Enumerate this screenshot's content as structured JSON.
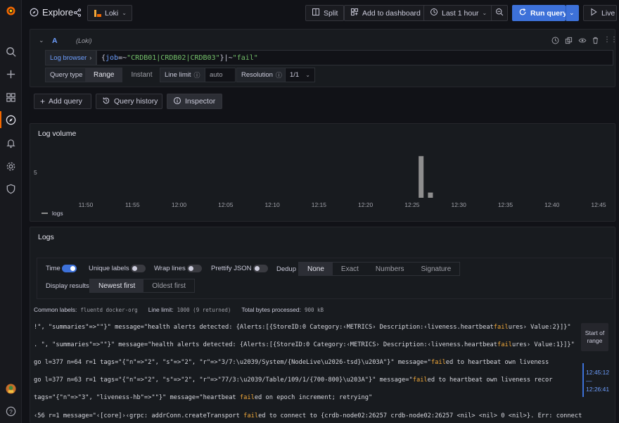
{
  "topbar": {
    "title": "Explore",
    "datasource": "Loki",
    "split": "Split",
    "add_to_dashboard": "Add to dashboard",
    "time_range": "Last 1 hour",
    "run_query": "Run query",
    "live": "Live"
  },
  "query": {
    "letter": "A",
    "datasource_label": "(Loki)",
    "log_browser": "Log browser",
    "expr_open": "{",
    "expr_job_key": "job",
    "expr_job_op": "=~",
    "expr_job_val": "\"CRDB01|CRDB02|CRDB03\"",
    "expr_close": "}",
    "expr_filter_op": "|~",
    "expr_filter_val": "\"fail\"",
    "query_type_label": "Query type",
    "range": "Range",
    "instant": "Instant",
    "line_limit_label": "Line limit",
    "line_limit_placeholder": "auto",
    "resolution_label": "Resolution",
    "resolution_value": "1/1"
  },
  "actions": {
    "add_query": "Add query",
    "query_history": "Query history",
    "inspector": "Inspector"
  },
  "log_volume": {
    "title": "Log volume",
    "y_tick": "5",
    "legend": "logs",
    "color": "#8e8e8e"
  },
  "chart_data": {
    "type": "bar",
    "title": "Log volume",
    "x_ticks": [
      "11:50",
      "11:55",
      "12:00",
      "12:05",
      "12:10",
      "12:15",
      "12:20",
      "12:25",
      "12:30",
      "12:35",
      "12:40",
      "12:45"
    ],
    "series": [
      {
        "name": "logs",
        "x": [
          "12:26",
          "12:27"
        ],
        "values": [
          8,
          1
        ]
      }
    ],
    "y_ticks": [
      "5"
    ]
  },
  "logs": {
    "title": "Logs",
    "time_label": "Time",
    "unique_labels": "Unique labels",
    "wrap_lines": "Wrap lines",
    "prettify_json": "Prettify JSON",
    "dedup_label": "Dedup",
    "dedup_options": [
      "None",
      "Exact",
      "Numbers",
      "Signature"
    ],
    "display_results_label": "Display results",
    "newest_first": "Newest first",
    "oldest_first": "Oldest first",
    "common_labels_label": "Common labels:",
    "common_label_values": "fluentd docker-org",
    "line_limit_text": "Line limit:",
    "line_limit_value": "1000 (9 returned)",
    "total_bytes_text": "Total bytes processed:",
    "total_bytes_value": "900 kB",
    "start_of_range": "Start of range",
    "range_top": "12:45:12",
    "range_dash": "—",
    "range_bottom": "12:26:41",
    "lines": [
      {
        "pre": "!\", \"summaries\"=>\"\"}\" message=\"health alerts detected: {Alerts:[{StoreID:0 Category:‹METRICS› Description:‹liveness.heartbeat",
        "hl": "fail",
        "post": "ures› Value:2}]}\""
      },
      {
        "pre": ". \", \"summaries\"=>\"\"}\" message=\"health alerts detected: {Alerts:[{StoreID:0 Category:‹METRICS› Description:‹liveness.heartbeat",
        "hl": "fail",
        "post": "ures› Value:1}]}\""
      },
      {
        "pre": " go l=377 n=64 r=1 tags=\"{\"n\"=>\"2\", \"s\"=>\"2\", \"r\"=>\"3/7:\\u2039/System/{NodeLive\\u2026-tsd}\\u203A\"}\" message=\"",
        "hl": "fail",
        "post": "ed to heartbeat own liveness"
      },
      {
        "pre": " go l=377 n=63 r=1 tags=\"{\"n\"=>\"2\", \"s\"=>\"2\", \"r\"=>\"77/3:\\u2039/Table/109/1/{700-800}\\u203A\"}\" message=\"",
        "hl": "fail",
        "post": "ed to heartbeat own liveness recor"
      },
      {
        "pre": " tags=\"{\"n\"=>\"3\", \"liveness-hb\"=>\"\"}\" message=\"heartbeat ",
        "hl": "fail",
        "post": "ed on epoch increment; retrying\""
      },
      {
        "pre": "‹56 r=1 message=\"‹[core]›‹grpc: addrConn.createTransport ",
        "hl": "fail",
        "post": "ed to connect to {crdb-node02:26257 crdb-node02:26257 <nil> <nil> 0 <nil>}. Err: connection erro"
      }
    ]
  },
  "colors": {
    "accent": "#3d71d9",
    "highlight": "#f2a93a"
  }
}
